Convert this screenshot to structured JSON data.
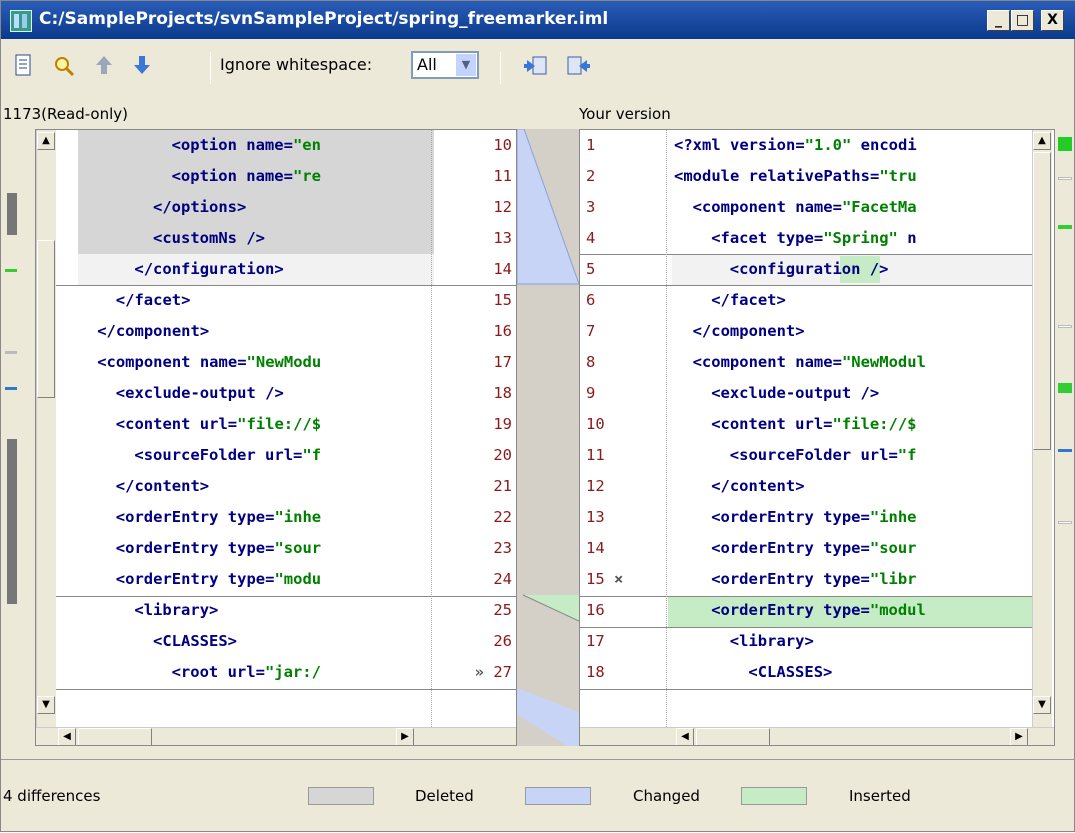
{
  "window": {
    "title": "C:/SampleProjects/svnSampleProject/spring_freemarker.iml",
    "controls": [
      "_",
      "□",
      "X"
    ]
  },
  "toolbar": {
    "icons": [
      "document-icon",
      "find-icon",
      "previous-diff-icon",
      "next-diff-icon",
      "apply-left-icon",
      "apply-right-icon"
    ],
    "ignore_whitespace_label": "Ignore whitespace:",
    "ignore_whitespace_value": "All"
  },
  "left": {
    "header": "1173(Read-only)",
    "lines": [
      {
        "num": "10",
        "text": "<option name=\"en"
      },
      {
        "num": "11",
        "text": "<option name=\"re"
      },
      {
        "num": "12",
        "text": "</options>"
      },
      {
        "num": "13",
        "text": "<customNs />"
      },
      {
        "num": "14",
        "text": "</configuration>"
      },
      {
        "num": "15",
        "text": "</facet>"
      },
      {
        "num": "16",
        "text": "</component>"
      },
      {
        "num": "17",
        "text": "<component name=\"NewModu"
      },
      {
        "num": "18",
        "text": "<exclude-output />"
      },
      {
        "num": "19",
        "text": "<content url=\"file://$"
      },
      {
        "num": "20",
        "text": "<sourceFolder url=\"f"
      },
      {
        "num": "21",
        "text": "</content>"
      },
      {
        "num": "22",
        "text": "<orderEntry type=\"inhe"
      },
      {
        "num": "23",
        "text": "<orderEntry type=\"sour"
      },
      {
        "num": "24",
        "text": "<orderEntry type=\"modu"
      },
      {
        "num": "25",
        "text": "<library>"
      },
      {
        "num": "26",
        "text": "<CLASSES>"
      },
      {
        "num": "27",
        "text": "<root url=\"jar:/",
        "marker": "»"
      }
    ]
  },
  "right": {
    "header": "Your version",
    "lines": [
      {
        "num": "1",
        "text": "<?xml version=\"1.0\" encodi"
      },
      {
        "num": "2",
        "text": "<module relativePaths=\"tru"
      },
      {
        "num": "3",
        "text": "<component name=\"FacetMa"
      },
      {
        "num": "4",
        "text": "<facet type=\"Spring\" n"
      },
      {
        "num": "5",
        "text": "<configuration />"
      },
      {
        "num": "6",
        "text": "</facet>"
      },
      {
        "num": "7",
        "text": "</component>"
      },
      {
        "num": "8",
        "text": "<component name=\"NewModul"
      },
      {
        "num": "9",
        "text": "<exclude-output />"
      },
      {
        "num": "10",
        "text": "<content url=\"file://$"
      },
      {
        "num": "11",
        "text": "<sourceFolder url=\"f"
      },
      {
        "num": "12",
        "text": "</content>"
      },
      {
        "num": "13",
        "text": "<orderEntry type=\"inhe"
      },
      {
        "num": "14",
        "text": "<orderEntry type=\"sour"
      },
      {
        "num": "15",
        "text": "<orderEntry type=\"libr",
        "marker": "×"
      },
      {
        "num": "16",
        "text": "<orderEntry type=\"modul"
      },
      {
        "num": "17",
        "text": "<library>"
      },
      {
        "num": "18",
        "text": "<CLASSES>"
      }
    ]
  },
  "status": {
    "differences": "4 differences",
    "legend": [
      {
        "label": "Deleted",
        "color": "#d6d6d6"
      },
      {
        "label": "Changed",
        "color": "#c8d4f5"
      },
      {
        "label": "Inserted",
        "color": "#c6ecc6"
      }
    ]
  }
}
